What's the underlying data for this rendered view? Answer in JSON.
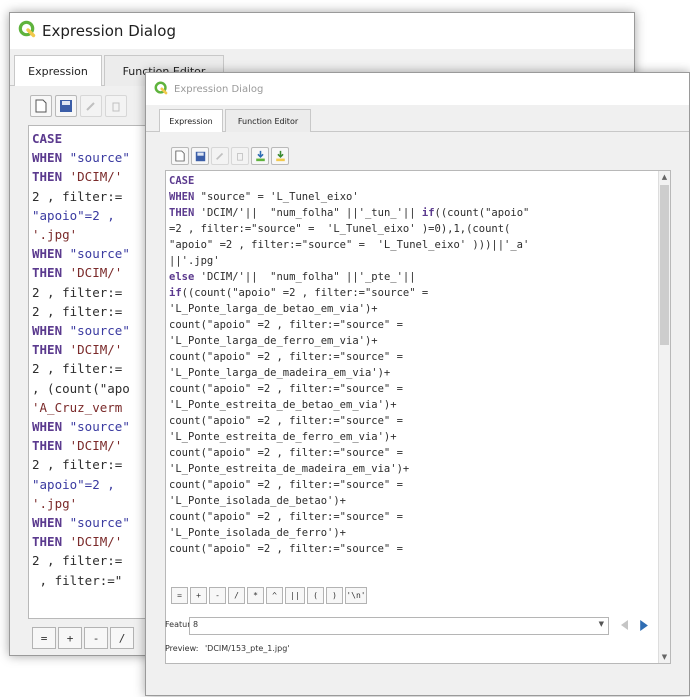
{
  "back_window": {
    "title": "Expression Dialog",
    "tabs": [
      "Expression",
      "Function Editor"
    ],
    "code_lines": [
      [
        {
          "t": "CASE",
          "c": "kw"
        }
      ],
      [
        {
          "t": "WHEN",
          "c": "kw"
        },
        {
          "t": " \"source\"",
          "c": "fld"
        }
      ],
      [
        {
          "t": "THEN",
          "c": "kw"
        },
        {
          "t": " 'DCIM/'",
          "c": "str"
        }
      ],
      [
        {
          "t": "2 , filter:=",
          "c": ""
        }
      ],
      [
        {
          "t": "\"apoio\"=2 ,",
          "c": "fld"
        }
      ],
      [
        {
          "t": "'.jpg'",
          "c": "str"
        }
      ],
      [
        {
          "t": "WHEN",
          "c": "kw"
        },
        {
          "t": " \"source\"",
          "c": "fld"
        }
      ],
      [
        {
          "t": "THEN",
          "c": "kw"
        },
        {
          "t": " 'DCIM/'",
          "c": "str"
        }
      ],
      [
        {
          "t": "2 , filter:=",
          "c": ""
        }
      ],
      [
        {
          "t": "2 , filter:=",
          "c": ""
        }
      ],
      [
        {
          "t": "WHEN",
          "c": "kw"
        },
        {
          "t": " \"source\"",
          "c": "fld"
        }
      ],
      [
        {
          "t": "THEN",
          "c": "kw"
        },
        {
          "t": " 'DCIM/'",
          "c": "str"
        }
      ],
      [
        {
          "t": "2 , filter:=",
          "c": ""
        }
      ],
      [
        {
          "t": ", (count(\"apo",
          "c": ""
        }
      ],
      [
        {
          "t": "'A_Cruz_verm",
          "c": "str"
        }
      ],
      [
        {
          "t": "WHEN",
          "c": "kw"
        },
        {
          "t": " \"source\"",
          "c": "fld"
        }
      ],
      [
        {
          "t": "THEN",
          "c": "kw"
        },
        {
          "t": " 'DCIM/'",
          "c": "str"
        }
      ],
      [
        {
          "t": "2 , filter:=",
          "c": ""
        }
      ],
      [
        {
          "t": "\"apoio\"=2 ,",
          "c": "fld"
        }
      ],
      [
        {
          "t": "'.jpg'",
          "c": "str"
        }
      ],
      [
        {
          "t": "WHEN",
          "c": "kw"
        },
        {
          "t": " \"source\"",
          "c": "fld"
        }
      ],
      [
        {
          "t": "THEN",
          "c": "kw"
        },
        {
          "t": " 'DCIM/'",
          "c": "str"
        }
      ],
      [
        {
          "t": "2 , filter:=",
          "c": ""
        }
      ],
      [
        {
          "t": " , filter:=\"",
          "c": ""
        }
      ]
    ],
    "operators": [
      "=",
      "+",
      "-",
      "/"
    ]
  },
  "front_window": {
    "title": "Expression Dialog",
    "tabs": [
      "Expression",
      "Function Editor"
    ],
    "code_lines": [
      [
        {
          "t": "CASE",
          "c": "kw"
        }
      ],
      [
        {
          "t": "WHEN",
          "c": "kw"
        },
        {
          "t": " \"source\" = 'L_Tunel_eixo'",
          "c": ""
        }
      ],
      [
        {
          "t": "THEN",
          "c": "kw"
        },
        {
          "t": " 'DCIM/'||  \"num_folha\" ||'_tun_'|| ",
          "c": ""
        },
        {
          "t": "if",
          "c": "kw"
        },
        {
          "t": "((count(\"apoio\"",
          "c": ""
        }
      ],
      [
        {
          "t": "=2 , filter:=\"source\" =  'L_Tunel_eixo' )=0),1,(count(",
          "c": ""
        }
      ],
      [
        {
          "t": "\"apoio\" =2 , filter:=\"source\" =  'L_Tunel_eixo' )))||'_a'",
          "c": ""
        }
      ],
      [
        {
          "t": "||'.jpg'",
          "c": ""
        }
      ],
      [
        {
          "t": "else",
          "c": "kw"
        },
        {
          "t": " 'DCIM/'||  \"num_folha\" ||'_pte_'||",
          "c": ""
        }
      ],
      [
        {
          "t": "if",
          "c": "kw"
        },
        {
          "t": "((count(\"apoio\" =2 , filter:=\"source\" =",
          "c": ""
        }
      ],
      [
        {
          "t": "'L_Ponte_larga_de_betao_em_via')+",
          "c": ""
        }
      ],
      [
        {
          "t": "count(\"apoio\" =2 , filter:=\"source\" =",
          "c": ""
        }
      ],
      [
        {
          "t": "'L_Ponte_larga_de_ferro_em_via')+",
          "c": ""
        }
      ],
      [
        {
          "t": "count(\"apoio\" =2 , filter:=\"source\" =",
          "c": ""
        }
      ],
      [
        {
          "t": "'L_Ponte_larga_de_madeira_em_via')+",
          "c": ""
        }
      ],
      [
        {
          "t": "count(\"apoio\" =2 , filter:=\"source\" =",
          "c": ""
        }
      ],
      [
        {
          "t": "'L_Ponte_estreita_de_betao_em_via')+",
          "c": ""
        }
      ],
      [
        {
          "t": "count(\"apoio\" =2 , filter:=\"source\" =",
          "c": ""
        }
      ],
      [
        {
          "t": "'L_Ponte_estreita_de_ferro_em_via')+",
          "c": ""
        }
      ],
      [
        {
          "t": "count(\"apoio\" =2 , filter:=\"source\" =",
          "c": ""
        }
      ],
      [
        {
          "t": "'L_Ponte_estreita_de_madeira_em_via')+",
          "c": ""
        }
      ],
      [
        {
          "t": "count(\"apoio\" =2 , filter:=\"source\" =",
          "c": ""
        }
      ],
      [
        {
          "t": "'L_Ponte_isolada_de_betao')+",
          "c": ""
        }
      ],
      [
        {
          "t": "count(\"apoio\" =2 , filter:=\"source\" =",
          "c": ""
        }
      ],
      [
        {
          "t": "'L_Ponte_isolada_de_ferro')+",
          "c": ""
        }
      ],
      [
        {
          "t": "count(\"apoio\" =2 , filter:=\"source\" =",
          "c": ""
        }
      ]
    ],
    "operators": [
      "=",
      "+",
      "-",
      "/",
      "*",
      "^",
      "||",
      "(",
      ")",
      "'\\n'"
    ],
    "feature_label": "Feature",
    "feature_value": "8",
    "preview_label": "Preview:",
    "preview_value": "'DCIM/153_pte_1.jpg'"
  },
  "toolbar_icons": [
    "new-file-icon",
    "save-icon",
    "edit-icon",
    "delete-icon",
    "import-icon",
    "export-icon"
  ],
  "colors": {
    "qgis_green": "#5fb33d",
    "qgis_yellow": "#f2c94c",
    "keyword": "#5b3a8e",
    "nav_blue": "#2f6db3"
  }
}
